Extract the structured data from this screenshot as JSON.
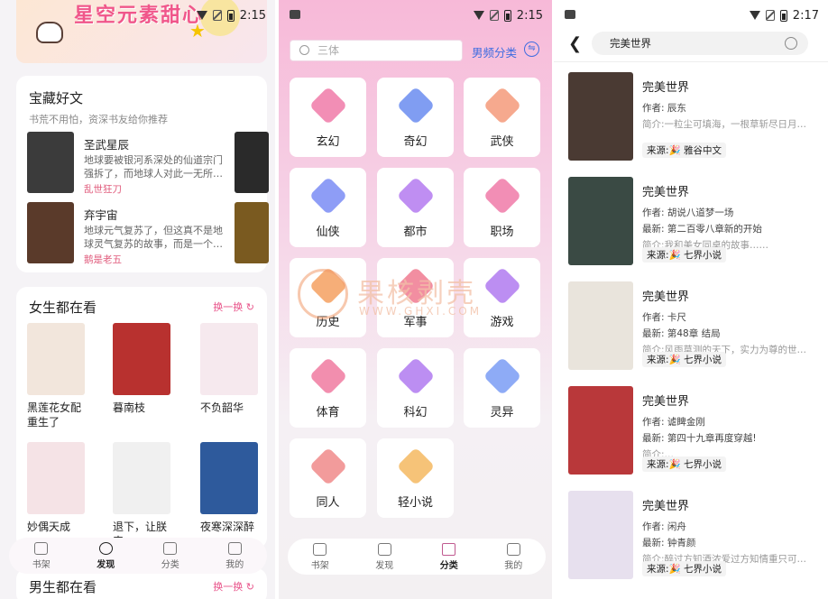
{
  "p1": {
    "time": "2:15",
    "banner_text": "星空元素甜心熊",
    "treasure": {
      "title": "宝藏好文",
      "subtitle": "书荒不用怕，资深书友给你推荐",
      "books": [
        {
          "title": "圣武星辰",
          "desc": "地球要被银河系深处的仙道宗门强拆了，而地球人对此一无所…",
          "author": "乱世狂刀",
          "color": "#3b3b3b"
        },
        {
          "title": "弃宇宙",
          "desc": "地球元气复苏了，但这真不是地球灵气复苏的故事，而是一个…",
          "author": "鹅是老五",
          "color": "#5a3a2a"
        }
      ]
    },
    "female": {
      "title": "女生都在看",
      "refresh": "换一换 ↻",
      "books": [
        {
          "title": "黑莲花女配重生了",
          "color": "#f2e6dc"
        },
        {
          "title": "暮南枝",
          "color": "#b8312f"
        },
        {
          "title": "不负韶华",
          "color": "#f6e9ee"
        },
        {
          "title": "妙偶天成",
          "color": "#f5e3e6"
        },
        {
          "title": "退下，让朕来",
          "color": "#f0f0f0"
        },
        {
          "title": "夜寒深深醉",
          "color": "#2e5a9c"
        }
      ]
    },
    "male": {
      "title": "男生都在看",
      "refresh": "换一换 ↻"
    },
    "tabs": [
      "书架",
      "发现",
      "分类",
      "我的"
    ],
    "active_tab": "发现"
  },
  "p2": {
    "time": "2:15",
    "search_placeholder": "三体",
    "gender": "男频分类",
    "swap_icon": "⇋",
    "categories": [
      {
        "label": "玄幻",
        "color": "#f07aa8"
      },
      {
        "label": "奇幻",
        "color": "#6a8cf0"
      },
      {
        "label": "武侠",
        "color": "#f59a7a"
      },
      {
        "label": "仙侠",
        "color": "#7a8cf5"
      },
      {
        "label": "都市",
        "color": "#b47af0"
      },
      {
        "label": "职场",
        "color": "#f07aa8"
      },
      {
        "label": "历史",
        "color": "#f5a060"
      },
      {
        "label": "军事",
        "color": "#f07a90"
      },
      {
        "label": "游戏",
        "color": "#b07af0"
      },
      {
        "label": "体育",
        "color": "#f07aa0"
      },
      {
        "label": "科幻",
        "color": "#b07af0"
      },
      {
        "label": "灵异",
        "color": "#7a9cf5"
      },
      {
        "label": "同人",
        "color": "#f08a8a"
      },
      {
        "label": "轻小说",
        "color": "#f5b860"
      }
    ],
    "tabs": [
      "书架",
      "发现",
      "分类",
      "我的"
    ],
    "active_tab": "分类",
    "watermark": {
      "title": "果核剥壳",
      "url": "WWW.GHXI.COM"
    }
  },
  "p3": {
    "time": "2:17",
    "query": "完美世界",
    "results": [
      {
        "title": "完美世界",
        "author": "作者: 辰东",
        "latest": "",
        "intro": "简介:一粒尘可填海，一根草斩尽日月…",
        "source": "来源:🎉 雅谷中文",
        "color": "#4a3a33"
      },
      {
        "title": "完美世界",
        "author": "作者: 胡说八道梦一场",
        "latest": "最新: 第二百零八章新的开始",
        "intro": "简介:我和美女同桌的故事……",
        "source": "来源:🎉 七界小说",
        "color": "#3a4a44"
      },
      {
        "title": "完美世界",
        "author": "作者: 卡尺",
        "latest": "最新: 第48章 结局",
        "intro": "简介:风雨莫测的天下，实力为尊的世…",
        "source": "来源:🎉 七界小说",
        "color": "#e9e4dc"
      },
      {
        "title": "完美世界",
        "author": "作者: 谑睥金刚",
        "latest": "最新: 第四十九章再度穿越!",
        "intro": "简介:…",
        "source": "来源:🎉 七界小说",
        "color": "#b9383a"
      },
      {
        "title": "完美世界",
        "author": "作者: 闲舟",
        "latest": "最新: 钟青颜",
        "intro": "简介:醉过方知酒浓爱过方知情重只可…",
        "source": "来源:🎉 七界小说",
        "color": "#e7e0ee"
      }
    ]
  }
}
